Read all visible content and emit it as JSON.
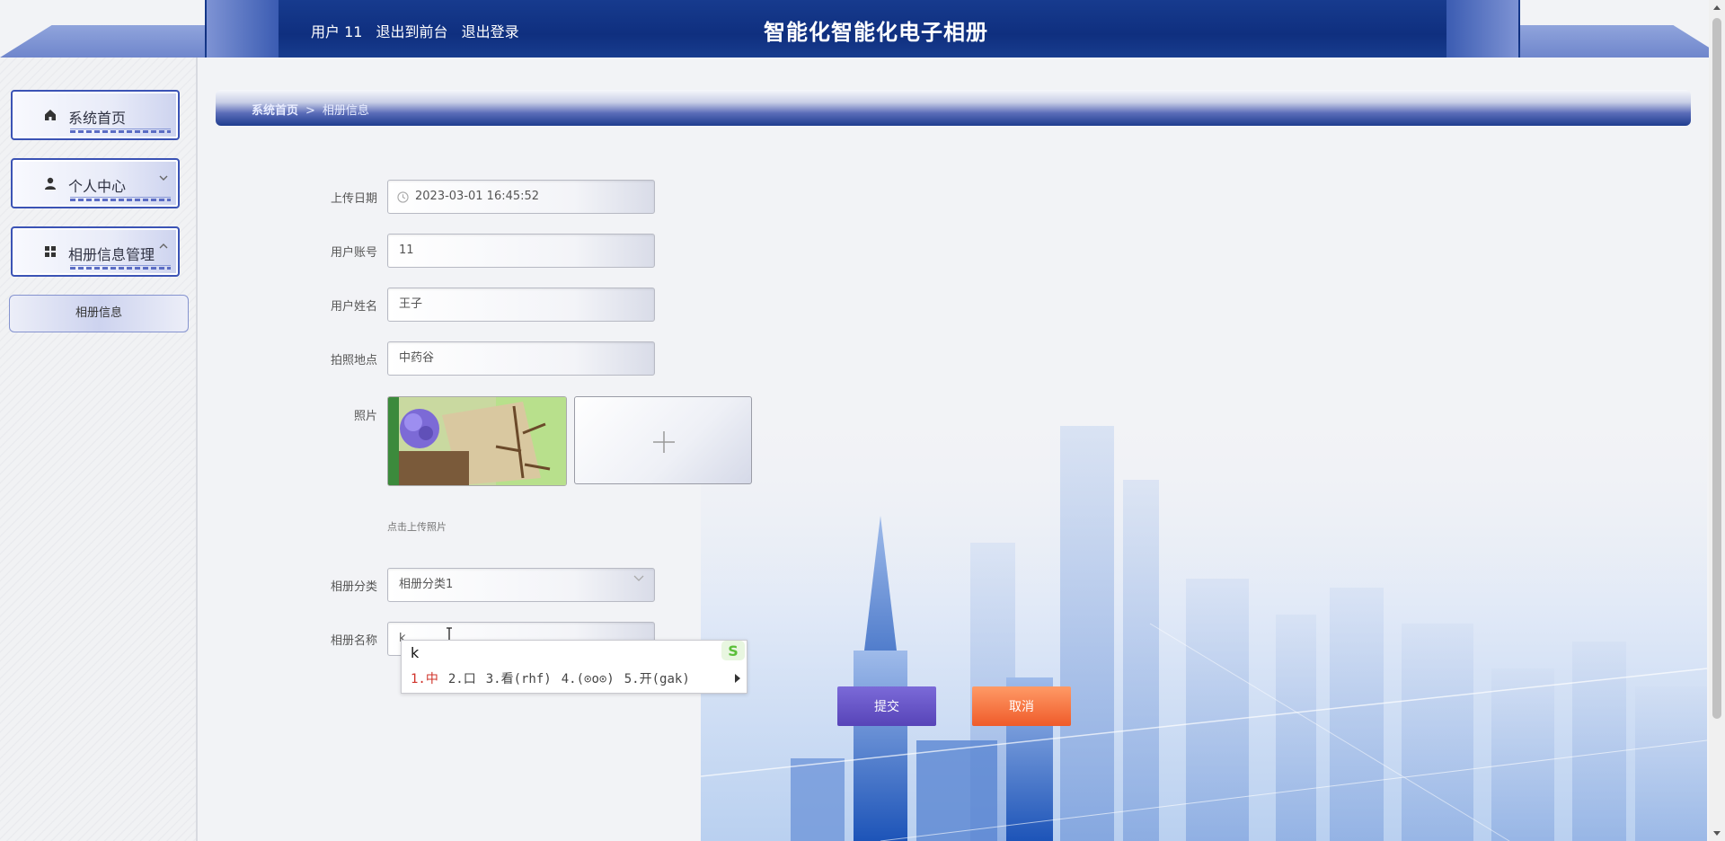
{
  "header": {
    "user_label": "用户 11",
    "to_frontend": "退出到前台",
    "logout": "退出登录",
    "title": "智能化智能化电子相册"
  },
  "sidebar": {
    "items": [
      {
        "label": "系统首页",
        "icon": "home-icon"
      },
      {
        "label": "个人中心",
        "icon": "user-icon",
        "caret": "chevron-down-icon"
      },
      {
        "label": "相册信息管理",
        "icon": "grid-icon",
        "caret": "chevron-up-icon"
      }
    ],
    "sub_item": "相册信息"
  },
  "breadcrumb": {
    "home": "系统首页",
    "separator": ">",
    "current": "相册信息"
  },
  "form": {
    "upload_date": {
      "label": "上传日期",
      "value": "2023-03-01 16:45:52"
    },
    "account": {
      "label": "用户账号",
      "value": "11"
    },
    "name": {
      "label": "用户姓名",
      "value": "王子"
    },
    "location": {
      "label": "拍照地点",
      "value": "中药谷"
    },
    "photo": {
      "label": "照片",
      "hint": "点击上传照片"
    },
    "category": {
      "label": "相册分类",
      "value": "相册分类1"
    },
    "album_name": {
      "label": "相册名称",
      "value": "k"
    }
  },
  "ime": {
    "input": "k",
    "candidates": [
      "1.中",
      "2.口",
      "3.看(rhf)",
      "4.(⊙o⊙)",
      "5.开(gak)"
    ]
  },
  "buttons": {
    "submit": "提交",
    "cancel": "取消"
  },
  "colors": {
    "header": "#0f2f7f",
    "submit": "#5744b8",
    "cancel": "#ef5b2a",
    "ime_highlight": "#d0332a"
  }
}
